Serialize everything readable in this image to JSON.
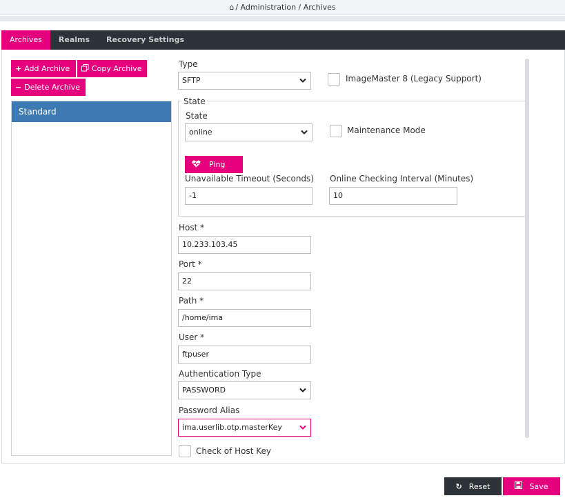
{
  "breadcrumb": {
    "home_icon": "home-icon",
    "text": "/ Administration / Archives"
  },
  "tabs": [
    {
      "label": "Archives",
      "active": true
    },
    {
      "label": "Realms",
      "active": false
    },
    {
      "label": "Recovery Settings",
      "active": false
    }
  ],
  "toolbar": {
    "add_label": "Add Archive",
    "copy_label": "Copy Archive",
    "delete_label": "Delete Archive"
  },
  "archives": [
    {
      "label": "Standard",
      "selected": true
    }
  ],
  "form": {
    "type_label": "Type",
    "type_value": "SFTP",
    "legacy_label": "ImageMaster 8 (Legacy Support)",
    "state_legend": "State",
    "state_label": "State",
    "state_value": "online",
    "maintenance_label": "Maintenance Mode",
    "ping_label": "Ping",
    "timeout_label": "Unavailable Timeout (Seconds)",
    "timeout_value": "-1",
    "interval_label": "Online Checking Interval (Minutes)",
    "interval_value": "10",
    "host_label": "Host *",
    "host_value": "10.233.103.45",
    "port_label": "Port *",
    "port_value": "22",
    "path_label": "Path *",
    "path_value": "/home/ima",
    "user_label": "User *",
    "user_value": "ftpuser",
    "auth_label": "Authentication Type",
    "auth_value": "PASSWORD",
    "alias_label": "Password Alias",
    "alias_value": "ima.userlib.otp.masterKey",
    "hostkey_label": "Check of Host Key"
  },
  "footer": {
    "reset_label": "Reset",
    "save_label": "Save"
  },
  "colors": {
    "accent": "#e6007e",
    "tabbar": "#2d3238",
    "selected_item": "#3d7ab3"
  }
}
